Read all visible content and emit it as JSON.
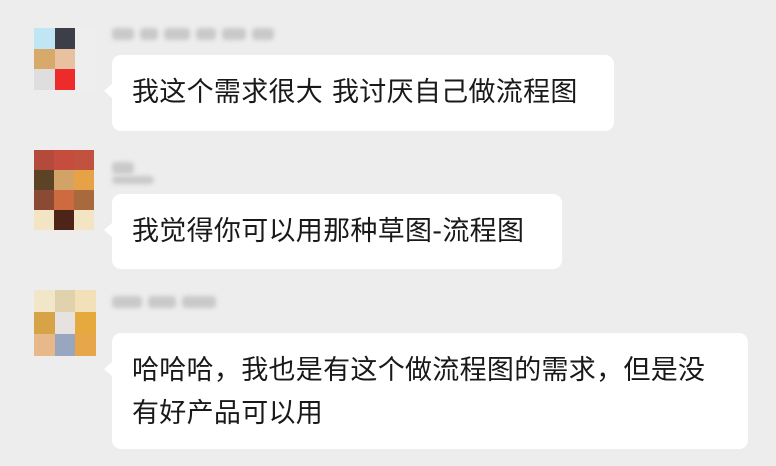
{
  "colors": {
    "background": "#ededed",
    "bubble": "#ffffff",
    "text": "#191919"
  },
  "messages": [
    {
      "text": "我这个需求很大 我讨厌自己做流程图",
      "avatar_pixels": [
        "#bfe6f2",
        "#3c3f48",
        "#eeeeee",
        "#d7a96a",
        "#e8c2a0",
        "#eeeeee",
        "#dedede",
        "#ee2b2b",
        "#eeeeee"
      ]
    },
    {
      "text": "我觉得你可以用那种草图-流程图",
      "avatar_pixels": [
        "#b34a3c",
        "#c44d3d",
        "#c0523f",
        "#5c4325",
        "#d3a266",
        "#e7a146",
        "#8a4a34",
        "#cd6a3f",
        "#a8693c",
        "#f3e5c3",
        "#4f2418",
        "#f3e5c3"
      ]
    },
    {
      "text": "哈哈哈，我也是有这个做流程图的需求，但是没有好产品可以用",
      "avatar_pixels": [
        "#f2e6c8",
        "#e0d2ac",
        "#f2e0b8",
        "#d6a447",
        "#e6e2e0",
        "#e5a93e",
        "#e7b889",
        "#98a6bf",
        "#e8a64a"
      ]
    }
  ]
}
